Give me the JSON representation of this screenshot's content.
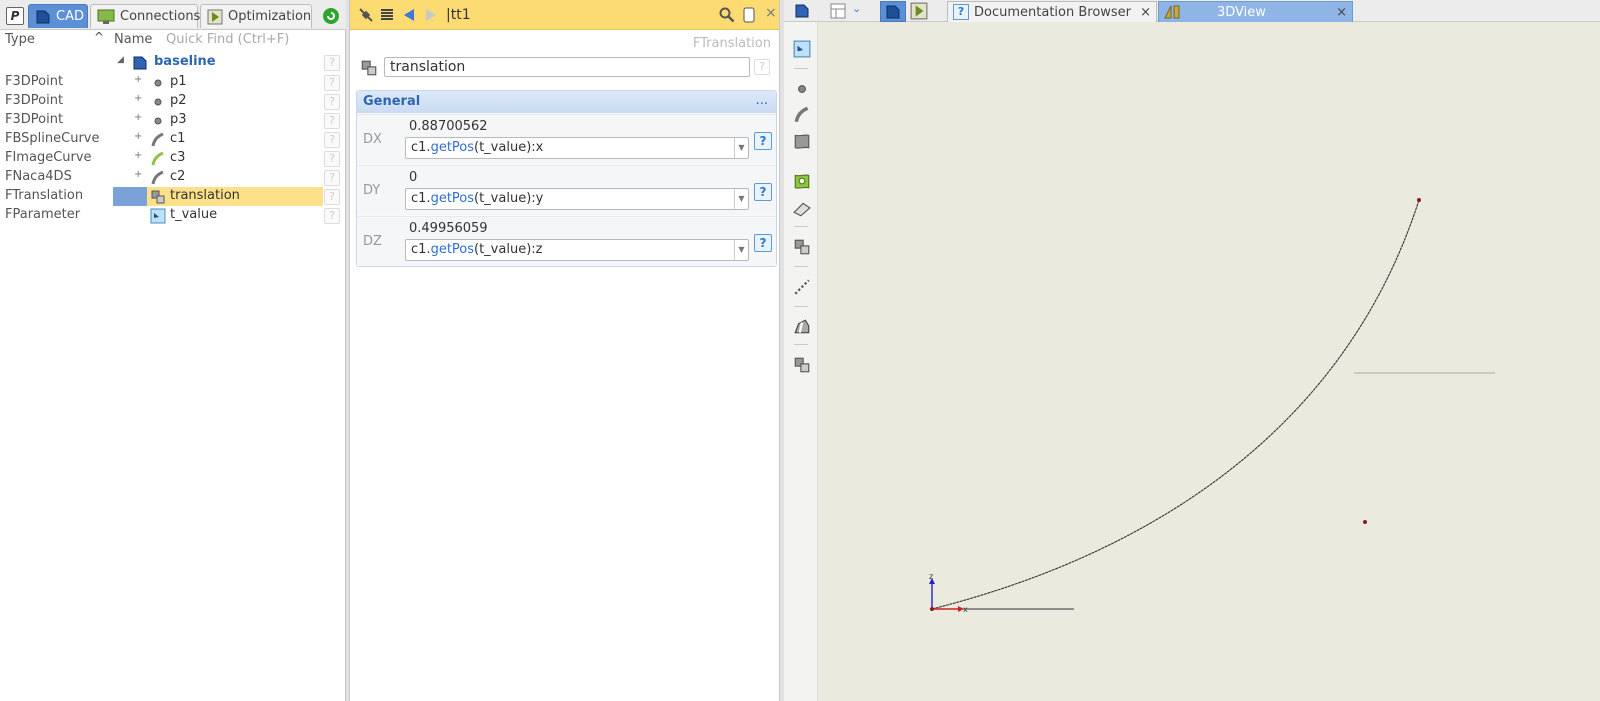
{
  "left_panel": {
    "p_button": "P",
    "tabs": [
      {
        "label": "CAD",
        "active": true
      },
      {
        "label": "Connections",
        "active": false
      },
      {
        "label": "Optimization",
        "active": false
      }
    ],
    "columns": {
      "type": "Type",
      "name": "Name",
      "quick_find_placeholder": "Quick Find (Ctrl+F)"
    },
    "root": {
      "name": "baseline"
    },
    "rows": [
      {
        "type": "F3DPoint",
        "name": "p1",
        "icon": "point-icon"
      },
      {
        "type": "F3DPoint",
        "name": "p2",
        "icon": "point-icon"
      },
      {
        "type": "F3DPoint",
        "name": "p3",
        "icon": "point-icon"
      },
      {
        "type": "FBSplineCurve",
        "name": "c1",
        "icon": "curve-icon"
      },
      {
        "type": "FImageCurve",
        "name": "c3",
        "icon": "image-curve-icon"
      },
      {
        "type": "FNaca4DS",
        "name": "c2",
        "icon": "curve-icon"
      },
      {
        "type": "FTranslation",
        "name": "translation",
        "icon": "translation-icon",
        "selected": true
      },
      {
        "type": "FParameter",
        "name": "t_value",
        "icon": "parameter-icon"
      }
    ],
    "help_glyph": "?"
  },
  "middle_panel": {
    "title": "|tt1",
    "type_label": "FTranslation",
    "name_value": "translation",
    "section_title": "General",
    "section_dots": "...",
    "properties": [
      {
        "label": "DX",
        "value": "0.88700562",
        "expr_obj": "c1.",
        "expr_fn": "getPos",
        "expr_rest": "(t_value):x"
      },
      {
        "label": "DY",
        "value": "0",
        "expr_obj": "c1.",
        "expr_fn": "getPos",
        "expr_rest": "(t_value):y"
      },
      {
        "label": "DZ",
        "value": "0.49956059",
        "expr_obj": "c1.",
        "expr_fn": "getPos",
        "expr_rest": "(t_value):z"
      }
    ],
    "help_glyph": "?"
  },
  "right_area": {
    "tabs": [
      {
        "label": "Documentation Browser",
        "close": "×",
        "active": false
      },
      {
        "label": "3DView",
        "close": "×",
        "active": true
      }
    ],
    "axis_labels": {
      "z": "z",
      "x": "x"
    }
  },
  "colors": {
    "accent_blue": "#2e66b0",
    "header_yellow": "#fcdc72",
    "selection_yellow": "#fde08a",
    "viewport_bg": "#ebeade"
  }
}
